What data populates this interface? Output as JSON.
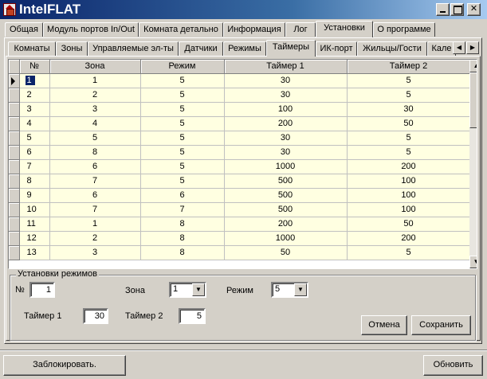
{
  "window": {
    "title": "IntelFLAT"
  },
  "main_tabs": [
    {
      "label": "Общая"
    },
    {
      "label": "Модуль портов In/Out"
    },
    {
      "label": "Комната детально"
    },
    {
      "label": "Информация"
    },
    {
      "label": "Лог"
    },
    {
      "label": "Установки"
    },
    {
      "label": "О программе"
    }
  ],
  "sub_tabs": [
    {
      "label": "Комнаты"
    },
    {
      "label": "Зоны"
    },
    {
      "label": "Управляемые эл-ты"
    },
    {
      "label": "Датчики"
    },
    {
      "label": "Режимы"
    },
    {
      "label": "Таймеры"
    },
    {
      "label": "ИК-порт"
    },
    {
      "label": "Жильцы/Гости"
    },
    {
      "label": "Кале"
    }
  ],
  "grid": {
    "columns": [
      "№",
      "Зона",
      "Режим",
      "Таймер 1",
      "Таймер 2"
    ],
    "current_row": 0,
    "rows": [
      [
        "1",
        "1",
        "5",
        "30",
        "5"
      ],
      [
        "2",
        "2",
        "5",
        "30",
        "5"
      ],
      [
        "3",
        "3",
        "5",
        "100",
        "30"
      ],
      [
        "4",
        "4",
        "5",
        "200",
        "50"
      ],
      [
        "5",
        "5",
        "5",
        "30",
        "5"
      ],
      [
        "6",
        "8",
        "5",
        "30",
        "5"
      ],
      [
        "7",
        "6",
        "5",
        "1000",
        "200"
      ],
      [
        "8",
        "7",
        "5",
        "500",
        "100"
      ],
      [
        "9",
        "6",
        "6",
        "500",
        "100"
      ],
      [
        "10",
        "7",
        "7",
        "500",
        "100"
      ],
      [
        "11",
        "1",
        "8",
        "200",
        "50"
      ],
      [
        "12",
        "2",
        "8",
        "1000",
        "200"
      ],
      [
        "13",
        "3",
        "8",
        "50",
        "5"
      ]
    ]
  },
  "settings": {
    "legend": "Установки режимов",
    "num_label": "№",
    "num_value": "1",
    "zone_label": "Зона",
    "zone_value": "1",
    "mode_label": "Режим",
    "mode_value": "5",
    "timer1_label": "Таймер 1",
    "timer1_value": "30",
    "timer2_label": "Таймер 2",
    "timer2_value": "5",
    "cancel_label": "Отмена",
    "save_label": "Сохранить"
  },
  "footer": {
    "lock_label": "Заблокировать.",
    "refresh_label": "Обновить"
  },
  "colors": {
    "titlebar_start": "#0a246a",
    "titlebar_end": "#a6caf0",
    "face": "#d4d0c8",
    "grid_row_bg": "#ffffe1",
    "selection": "#0a246a"
  }
}
